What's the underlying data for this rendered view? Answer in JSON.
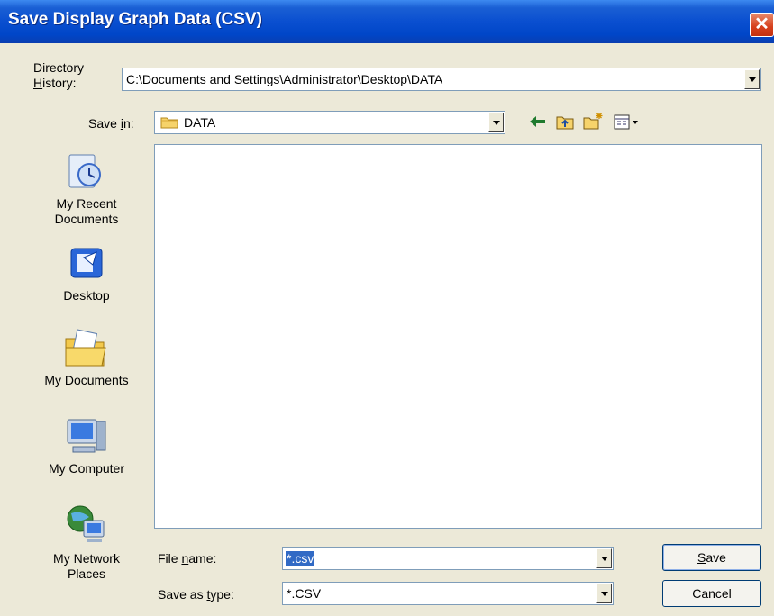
{
  "window": {
    "title": "Save Display Graph Data (CSV)",
    "close_glyph": "✕"
  },
  "directory_history": {
    "label_line1": "Directory",
    "label_line2_u": "H",
    "label_line2_rest": "istory:",
    "value": "C:\\Documents and Settings\\Administrator\\Desktop\\DATA"
  },
  "save_in": {
    "label_pre": "Save ",
    "label_u": "i",
    "label_post": "n:",
    "value": "DATA"
  },
  "toolbar": {
    "back_icon": "back-arrow-icon",
    "up_icon": "up-folder-icon",
    "new_folder_icon": "new-folder-icon",
    "views_icon": "views-menu-icon"
  },
  "places": [
    {
      "line1": "My Recent",
      "line2": "Documents",
      "icon": "recent-documents-icon"
    },
    {
      "line1": "Desktop",
      "line2": "",
      "icon": "desktop-icon"
    },
    {
      "line1": "My Documents",
      "line2": "",
      "icon": "my-documents-icon"
    },
    {
      "line1": "My Computer",
      "line2": "",
      "icon": "my-computer-icon"
    },
    {
      "line1": "My Network",
      "line2": "Places",
      "icon": "network-places-icon"
    }
  ],
  "file_name": {
    "label_pre": "File ",
    "label_u": "n",
    "label_post": "ame:",
    "value": "*.csv"
  },
  "save_as_type": {
    "label_pre": "Save as ",
    "label_u": "t",
    "label_post": "ype:",
    "value": "*.CSV"
  },
  "buttons": {
    "save_u": "S",
    "save_rest": "ave",
    "cancel": "Cancel"
  },
  "colors": {
    "titlebar": "#0a4fd0",
    "selection": "#316ac5",
    "dialog_bg": "#ece9d8"
  }
}
